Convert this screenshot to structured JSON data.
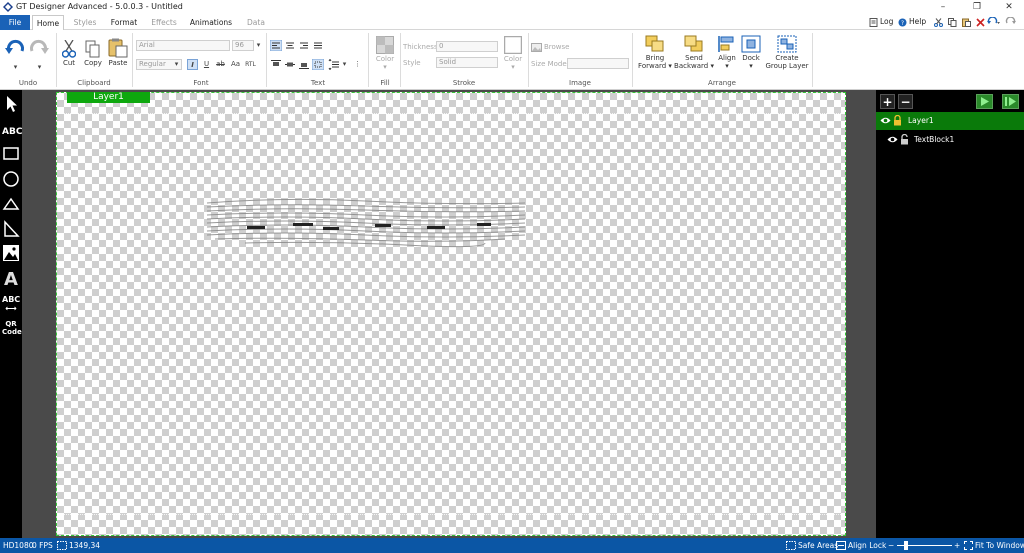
{
  "window": {
    "title": "GT Designer Advanced - 5.0.0.3 - Untitled",
    "minimize": "–",
    "restore": "❐",
    "close": "✕"
  },
  "menu": {
    "file": "File",
    "tabs": [
      "Home",
      "Styles",
      "Format",
      "Effects",
      "Animations",
      "Data"
    ],
    "log": "Log",
    "help": "Help"
  },
  "ribbon": {
    "undo_group": "Undo",
    "clipboard": {
      "cut": "Cut",
      "copy": "Copy",
      "paste": "Paste",
      "label": "Clipboard"
    },
    "font": {
      "family": "Arial",
      "size": "96",
      "style": "Regular",
      "label": "Font"
    },
    "text_label": "Text",
    "fill": {
      "color": "Color",
      "label": "Fill"
    },
    "stroke": {
      "thickness_label": "Thickness",
      "thickness_value": "0",
      "style_label": "Style",
      "style_value": "Solid",
      "color": "Color",
      "label": "Stroke"
    },
    "image": {
      "browse": "Browse",
      "size_mode": "Size Mode",
      "label": "Image"
    },
    "arrange": {
      "bring_forward_1": "Bring",
      "bring_forward_2": "Forward",
      "send_backward_1": "Send",
      "send_backward_2": "Backward",
      "align": "Align",
      "dock": "Dock",
      "create_group_1": "Create",
      "create_group_2": "Group Layer",
      "label": "Arrange"
    }
  },
  "tools": {
    "text": "ABC",
    "text_scroll": "ABC",
    "qr_1": "QR",
    "qr_2": "Code"
  },
  "canvas": {
    "layer_tag": "Layer1"
  },
  "layers": [
    {
      "name": "Layer1",
      "selected": true
    },
    {
      "name": "TextBlock1",
      "selected": false
    }
  ],
  "status": {
    "resolution": "HD1080",
    "fps": "0 FPS",
    "coords": "1349,34",
    "safe_areas": "Safe Areas",
    "align_lock": "Align Lock",
    "fit": "Fit To Window"
  },
  "colors": {
    "accent": "#1a62b7",
    "layer_green": "#0ea80e",
    "status_bar": "#0b56a5"
  }
}
